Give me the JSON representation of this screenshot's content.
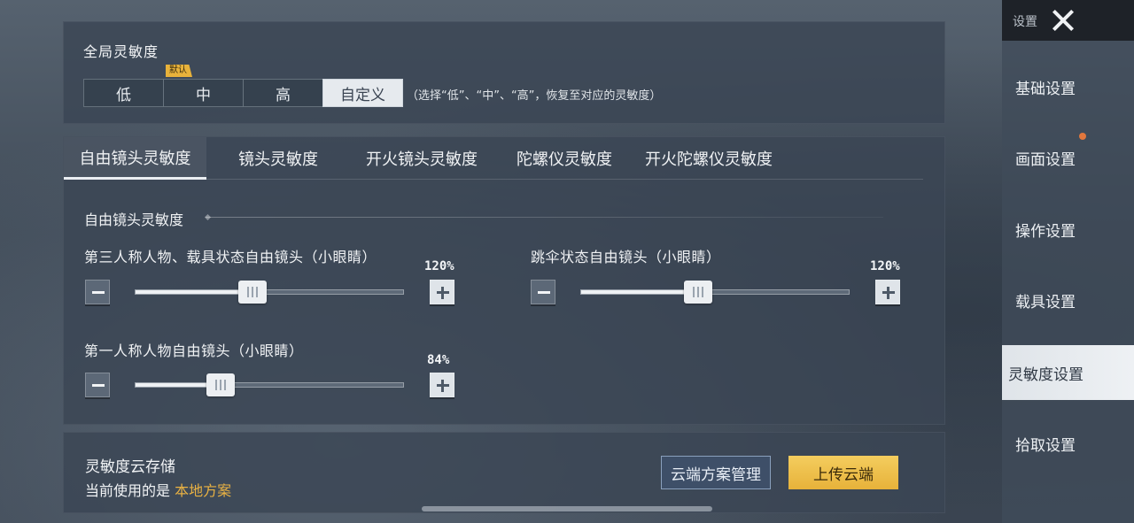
{
  "global": {
    "title": "全局灵敏度",
    "presets": [
      "低",
      "中",
      "高",
      "自定义"
    ],
    "default_badge": "默认",
    "hint": "（选择“低”、“中”、“高”，恢复至对应的灵敏度）"
  },
  "tabs": [
    "自由镜头灵敏度",
    "镜头灵敏度",
    "开火镜头灵敏度",
    "陀螺仪灵敏度",
    "开火陀螺仪灵敏度"
  ],
  "section_title": "自由镜头灵敏度",
  "sliders": [
    {
      "label": "第三人称人物、载具状态自由镜头（小眼睛）",
      "value_text": "120%",
      "fraction": 0.4
    },
    {
      "label": "跳伞状态自由镜头（小眼睛）",
      "value_text": "120%",
      "fraction": 0.4
    },
    {
      "label": "第一人称人物自由镜头（小眼睛）",
      "value_text": "84%",
      "fraction": 0.28
    }
  ],
  "cloud": {
    "title": "灵敏度云存储",
    "status_prefix": "当前使用的是",
    "plan": "本地方案",
    "manage_label": "云端方案管理",
    "upload_label": "上传云端"
  },
  "sidebar": {
    "title": "设置",
    "items": [
      "基础设置",
      "画面设置",
      "操作设置",
      "载具设置",
      "灵敏度设置",
      "拾取设置"
    ],
    "active_index": 4
  },
  "colors": {
    "accent_gold": "#e9b243",
    "notification": "#e2773d"
  }
}
